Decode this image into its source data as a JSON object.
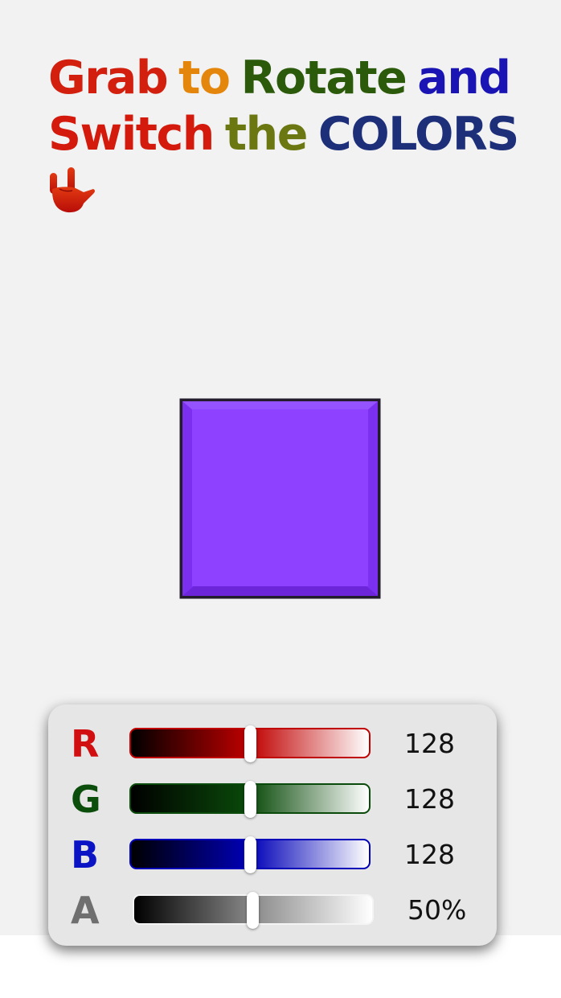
{
  "headline": {
    "words": [
      {
        "text": "Grab",
        "color": "#d21f0e"
      },
      {
        "text": "to",
        "color": "#e4860b"
      },
      {
        "text": "Rotate",
        "color": "#2c5a0b"
      },
      {
        "text": "and",
        "color": "#1a14b4"
      }
    ],
    "words_line2": [
      {
        "text": "Switch",
        "color": "#d31a0c"
      },
      {
        "text": "the",
        "color": "#6b7710"
      },
      {
        "text": "COLORS",
        "color": "#1e2f7a"
      }
    ],
    "hand_icon": "rock-hand-icon"
  },
  "cube": {
    "face_color": "#8e42ff",
    "bevel_color": "#7a30ee",
    "border_color": "#221c2c"
  },
  "color_panel": {
    "sliders": [
      {
        "channel": "R",
        "letter_color": "#d10f10",
        "track_color": "#c00000",
        "value": 128,
        "value_text": "128"
      },
      {
        "channel": "G",
        "letter_color": "#0b4d0b",
        "track_color": "#0a4a0a",
        "value": 128,
        "value_text": "128"
      },
      {
        "channel": "B",
        "letter_color": "#0a14c4",
        "track_color": "#0000b8",
        "value": 128,
        "value_text": "128"
      },
      {
        "channel": "A",
        "letter_color": "#6f6f6f",
        "track_color": "#8a8a8a",
        "value": 0.5,
        "value_text": "50%"
      }
    ]
  }
}
